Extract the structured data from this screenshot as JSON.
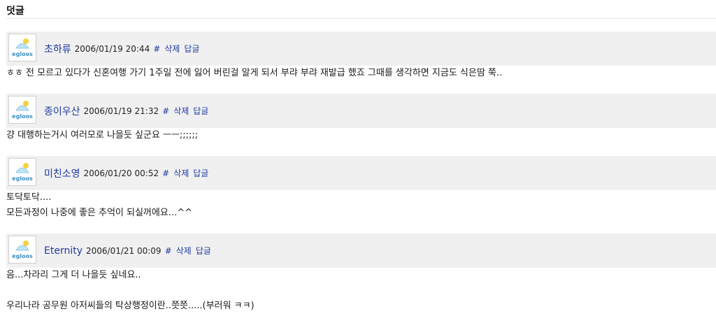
{
  "section": {
    "title": "덧글"
  },
  "comments": [
    {
      "author": "초하류",
      "date": "2006/01/19 20:44",
      "hash": "#",
      "delete_label": "삭제",
      "reply_label": "답글",
      "avatar_text": "egloos",
      "lines": [
        "ㅎㅎ 전 모르고 있다가 신혼여행 가기 1주일 전에 잃어 버린걸 알게 되서 부랴 부랴 재발급 했죠 그때를 생각하면 지금도 식은땀 쭉.."
      ]
    },
    {
      "author": "종이우산",
      "date": "2006/01/19 21:32",
      "hash": "#",
      "delete_label": "삭제",
      "reply_label": "답글",
      "avatar_text": "egloos",
      "lines": [
        "걍 대행하는거시 여러모로 나을듯 싶군요 ㅡㅡ;;;;;;"
      ]
    },
    {
      "author": "미친소영",
      "date": "2006/01/20 00:52",
      "hash": "#",
      "delete_label": "삭제",
      "reply_label": "답글",
      "avatar_text": "egloos",
      "lines": [
        "토닥토닥....",
        "모든과정이 나중에 좋은 추억이 되실꺼에요...^^"
      ]
    },
    {
      "author": "Eternity",
      "date": "2006/01/21 00:09",
      "hash": "#",
      "delete_label": "삭제",
      "reply_label": "답글",
      "avatar_text": "egloos",
      "lines": [
        "음...차라리 그게 더 나을듯 싶네요..",
        "",
        "우리나라 공무원 아저씨들의 탁상행정이란..쯧쯧.....(부러워 ㅋㅋ)"
      ]
    }
  ],
  "colors": {
    "header_bg": "#f0f0f0",
    "link": "#1f3aa0",
    "text": "#1a1a1a"
  }
}
